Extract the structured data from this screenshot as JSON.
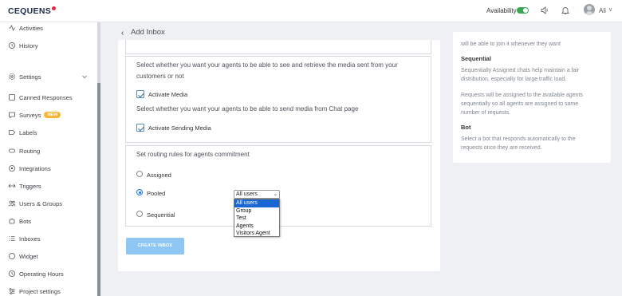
{
  "brand": {
    "name": "CEQUENS"
  },
  "topbar": {
    "availability_label": "Availability",
    "availability_on": true,
    "user_name": "Ali"
  },
  "sidebar": {
    "items": [
      {
        "label": "Activities",
        "icon": "activity-icon"
      },
      {
        "label": "History",
        "icon": "history-icon"
      },
      {
        "label": "Settings",
        "icon": "gear-icon"
      },
      {
        "label": "Canned Responses",
        "icon": "canned-responses-icon"
      },
      {
        "label": "Surveys",
        "icon": "surveys-icon",
        "badge": "NEW"
      },
      {
        "label": "Labels",
        "icon": "label-icon"
      },
      {
        "label": "Routing",
        "icon": "routing-icon"
      },
      {
        "label": "Integrations",
        "icon": "integrations-icon"
      },
      {
        "label": "Triggers",
        "icon": "triggers-icon"
      },
      {
        "label": "Users & Groups",
        "icon": "users-icon"
      },
      {
        "label": "Bots",
        "icon": "bot-icon"
      },
      {
        "label": "Inboxes",
        "icon": "inbox-icon"
      },
      {
        "label": "Widget",
        "icon": "widget-icon"
      },
      {
        "label": "Operating Hours",
        "icon": "clock-icon"
      },
      {
        "label": "Project settings",
        "icon": "project-settings-icon"
      }
    ]
  },
  "header": {
    "back_label": "‹",
    "title": "Add Inbox"
  },
  "media": {
    "retrieve_desc_line1": "Select whether you want your agents to be able to see and retrieve the media sent from your",
    "retrieve_desc_line2": "customers or not",
    "activate_media_label": "Activate Media",
    "activate_media_checked": true,
    "send_desc": "Select whether you want your agents to be able to send media from Chat page",
    "activate_sending_label": "Activate Sending Media",
    "activate_sending_checked": true
  },
  "routing": {
    "desc": "Set routing rules for agents commitment",
    "options": [
      {
        "label": "Assigned",
        "selected": false
      },
      {
        "label": "Pooled",
        "selected": true
      },
      {
        "label": "Sequential",
        "selected": false
      }
    ],
    "pool_select": {
      "value": "All users",
      "options": [
        "All users",
        "Group",
        "Test",
        "Agents",
        "Visitors Agent"
      ],
      "highlighted": "All users"
    }
  },
  "actions": {
    "create_label": "CREATE INBOX"
  },
  "help": {
    "pooled_tail": "will be able to join it whenever they want",
    "sequential_title": "Sequential",
    "sequential_p1_l1": "Sequentially Assigned chats help maintain a fair",
    "sequential_p1_l2": "distribution, especially for large traffic load.",
    "sequential_p2_l1": "Requests will be assigned to the available agents",
    "sequential_p2_l2": "sequentially so all agents are assigned to same",
    "sequential_p2_l3": "number of requests.",
    "bot_title": "Bot",
    "bot_p_l1": "Select a bot that responds automatically to the",
    "bot_p_l2": "requests once they are received."
  }
}
